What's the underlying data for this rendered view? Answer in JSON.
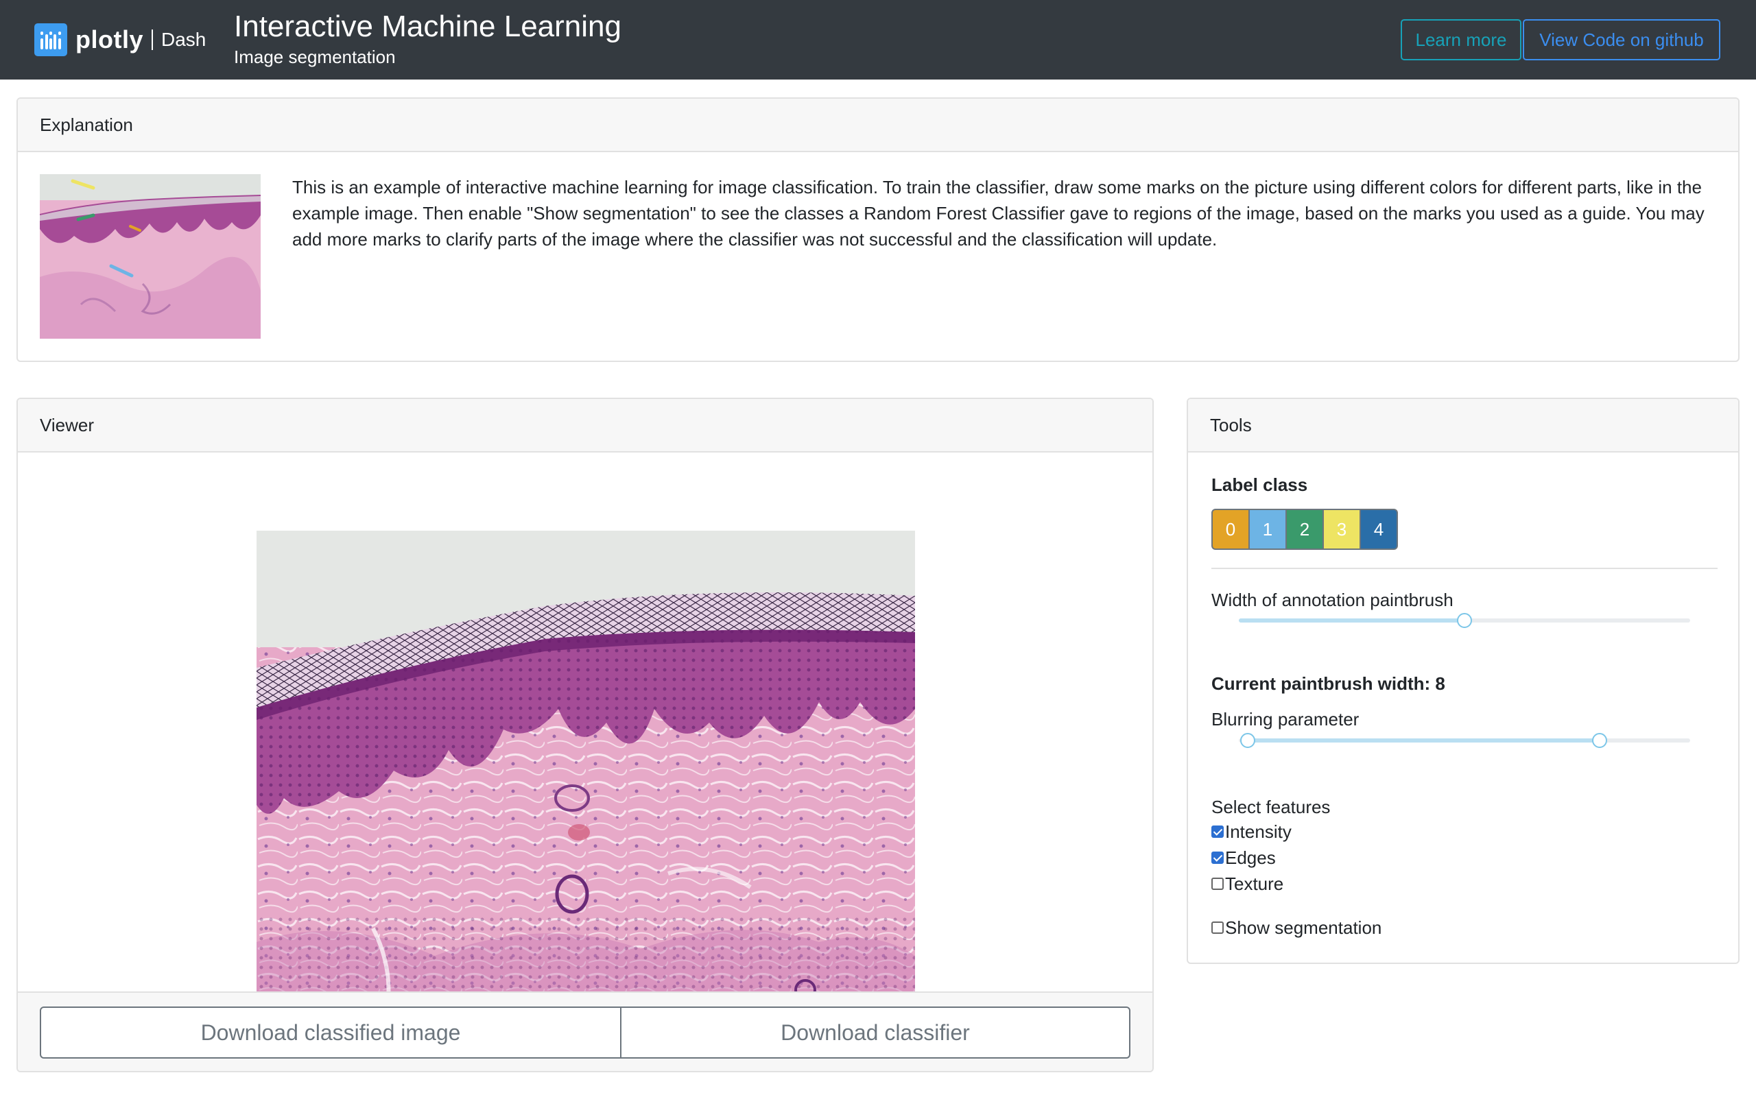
{
  "header": {
    "logo_text": "plotly",
    "logo_product": "Dash",
    "title": "Interactive Machine Learning",
    "subtitle": "Image segmentation",
    "learn_more_label": "Learn more",
    "github_label": "View Code on github"
  },
  "explanation": {
    "header": "Explanation",
    "text": "This is an example of interactive machine learning for image classification. To train the classifier, draw some marks on the picture using different colors for different parts, like in the example image. Then enable \"Show segmentation\" to see the classes a Random Forest Classifier gave to regions of the image, based on the marks you used as a guide. You may add more marks to clarify parts of the image where the classifier was not successful and the classification will update."
  },
  "viewer": {
    "header": "Viewer",
    "download_image_label": "Download classified image",
    "download_classifier_label": "Download classifier"
  },
  "tools": {
    "header": "Tools",
    "label_class_title": "Label class",
    "label_classes": [
      {
        "label": "0",
        "color": "#e3a326"
      },
      {
        "label": "1",
        "color": "#6db4e5"
      },
      {
        "label": "2",
        "color": "#3a9a6b"
      },
      {
        "label": "3",
        "color": "#eee463"
      },
      {
        "label": "4",
        "color": "#2a6ea8"
      }
    ],
    "paintbrush_label": "Width of annotation paintbrush",
    "paintbrush_fraction": 0.5,
    "current_width_text": "Current paintbrush width: 8",
    "blur_label": "Blurring parameter",
    "blur_range_fraction": [
      0.02,
      0.8
    ],
    "features_label": "Select features",
    "features": [
      {
        "label": "Intensity",
        "checked": true
      },
      {
        "label": "Edges",
        "checked": true
      },
      {
        "label": "Texture",
        "checked": false
      }
    ],
    "show_segmentation": {
      "label": "Show segmentation",
      "checked": false
    }
  },
  "icons": {
    "logo": "plotly-logo-icon",
    "checkbox": "checkbox-icon"
  },
  "colors": {
    "header_bg": "#343a40",
    "learn_more": "#17a2b8",
    "github": "#3b8ef0",
    "slider_fill": "#b9dff2",
    "tissue_pink": "#e7a9c8",
    "tissue_purple": "#9b3f8c"
  }
}
